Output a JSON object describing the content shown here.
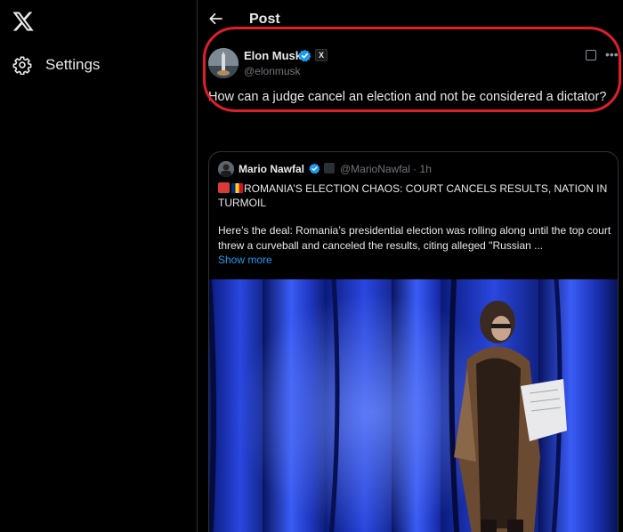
{
  "nav": {
    "settings_label": "Settings"
  },
  "header": {
    "title": "Post"
  },
  "post": {
    "author_name": "Elon Musk",
    "author_handle": "@elonmusk",
    "affiliation_badge": "X",
    "text": "How can a judge cancel an election and not be considered a dictator?"
  },
  "quote": {
    "author_name": "Mario Nawfal",
    "meta": "@MarioNawfal · 1h",
    "headline": "ROMANIA’S ELECTION CHAOS: COURT CANCELS RESULTS, NATION IN TURMOIL",
    "body": "Here’s the deal: Romania’s presidential election was rolling along until the top court threw a curveball and canceled the results, citing alleged \"Russian ...",
    "show_more": "Show more"
  },
  "colors": {
    "accent": "#1d9bf0",
    "highlight": "#e11d2a",
    "background": "#000000",
    "text": "#e7e9ea",
    "muted": "#71767b"
  }
}
